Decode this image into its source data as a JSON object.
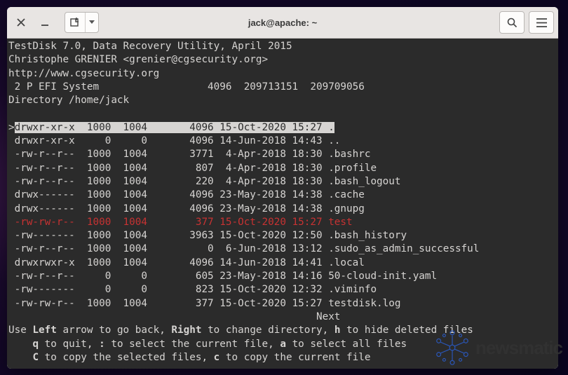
{
  "titlebar": {
    "title": "jack@apache: ~"
  },
  "header": {
    "line1": "TestDisk 7.0, Data Recovery Utility, April 2015",
    "line2": "Christophe GRENIER <grenier@cgsecurity.org>",
    "line3": "http://www.cgsecurity.org",
    "line4": " 2 P EFI System                  4096  209713151  209709056",
    "line5": "Directory /home/jack"
  },
  "listing": {
    "cursor": ">",
    "rows": [
      {
        "perm": "drwxr-xr-x",
        "uid": "1000",
        "gid": "1004",
        "size": "4096",
        "date": "15-Oct-2020 15:27",
        "name": ".",
        "hl": true
      },
      {
        "perm": "drwxr-xr-x",
        "uid": "0",
        "gid": "0",
        "size": "4096",
        "date": "14-Jun-2018 14:43",
        "name": ".."
      },
      {
        "perm": "-rw-r--r--",
        "uid": "1000",
        "gid": "1004",
        "size": "3771",
        "date": " 4-Apr-2018 18:30",
        "name": ".bashrc"
      },
      {
        "perm": "-rw-r--r--",
        "uid": "1000",
        "gid": "1004",
        "size": "807",
        "date": " 4-Apr-2018 18:30",
        "name": ".profile"
      },
      {
        "perm": "-rw-r--r--",
        "uid": "1000",
        "gid": "1004",
        "size": "220",
        "date": " 4-Apr-2018 18:30",
        "name": ".bash_logout"
      },
      {
        "perm": "drwx------",
        "uid": "1000",
        "gid": "1004",
        "size": "4096",
        "date": "23-May-2018 14:38",
        "name": ".cache"
      },
      {
        "perm": "drwx------",
        "uid": "1000",
        "gid": "1004",
        "size": "4096",
        "date": "23-May-2018 14:38",
        "name": ".gnupg"
      },
      {
        "perm": "-rw-rw-r--",
        "uid": "1000",
        "gid": "1004",
        "size": "377",
        "date": "15-Oct-2020 15:27",
        "name": "test",
        "red": true
      },
      {
        "perm": "-rw-------",
        "uid": "1000",
        "gid": "1004",
        "size": "3963",
        "date": "15-Oct-2020 12:50",
        "name": ".bash_history"
      },
      {
        "perm": "-rw-r--r--",
        "uid": "1000",
        "gid": "1004",
        "size": "0",
        "date": " 6-Jun-2018 13:12",
        "name": ".sudo_as_admin_successful"
      },
      {
        "perm": "drwxrwxr-x",
        "uid": "1000",
        "gid": "1004",
        "size": "4096",
        "date": "14-Jun-2018 14:41",
        "name": ".local"
      },
      {
        "perm": "-rw-r--r--",
        "uid": "0",
        "gid": "0",
        "size": "605",
        "date": "23-May-2018 14:16",
        "name": "50-cloud-init.yaml"
      },
      {
        "perm": "-rw-------",
        "uid": "0",
        "gid": "0",
        "size": "823",
        "date": "15-Oct-2020 12:32",
        "name": ".viminfo"
      },
      {
        "perm": "-rw-rw-r--",
        "uid": "1000",
        "gid": "1004",
        "size": "377",
        "date": "15-Oct-2020 15:27",
        "name": "testdisk.log"
      }
    ],
    "next": "                                                   Next"
  },
  "footer": {
    "use": "Use ",
    "left": "Left",
    "t1": " arrow to go back, ",
    "right": "Right",
    "t2": " to change directory, ",
    "h": "h",
    "t3": " to hide deleted files",
    "q": "q",
    "t4": " to quit, ",
    "colon": ":",
    "t5": " to select the current file, ",
    "a": "a",
    "t6": " to select all files",
    "C": "C",
    "t7": " to copy the selected files, ",
    "c": "c",
    "t8": " to copy the current file"
  },
  "watermark": {
    "text": "newsmatic"
  }
}
